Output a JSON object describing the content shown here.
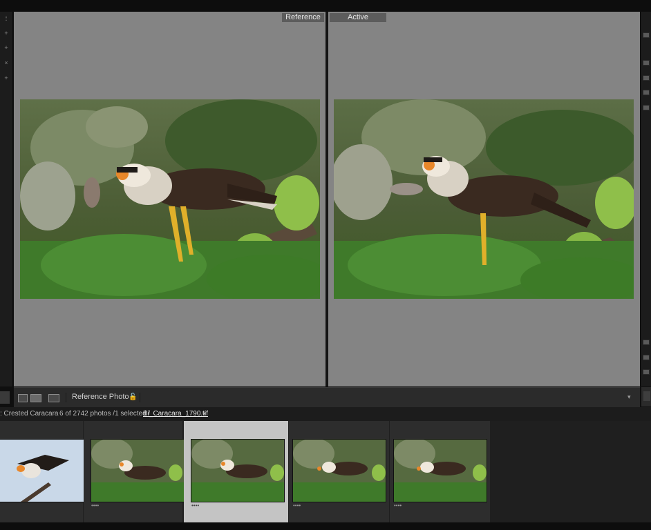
{
  "compare_view": {
    "reference_label": "Reference",
    "active_label": "Active"
  },
  "toolbar": {
    "view_buttons": [
      "grid-view",
      "compare-view",
      "survey-view"
    ],
    "reference_photo_label": "Reference Photo :"
  },
  "filmstrip_bar": {
    "collection": ": Crested Caracara",
    "count": "6 of 2742 photos /1 selected /",
    "filename": "Bi_Caracara_1790.tif",
    "filename_arrow": "▾"
  },
  "filmstrip": {
    "thumbs": [
      {
        "name": "thumb-flying-bird",
        "selected": false,
        "dots": ""
      },
      {
        "name": "thumb-caracara-1",
        "selected": false,
        "dots": "••••"
      },
      {
        "name": "thumb-caracara-2",
        "selected": true,
        "dots": "••••"
      },
      {
        "name": "thumb-caracara-3",
        "selected": false,
        "dots": "••••"
      },
      {
        "name": "thumb-caracara-4",
        "selected": false,
        "dots": "••••"
      }
    ]
  },
  "colors": {
    "pane_gray": "#848484",
    "panel_dark": "#2b2b2b",
    "selected_cell": "#c4c4c4"
  }
}
